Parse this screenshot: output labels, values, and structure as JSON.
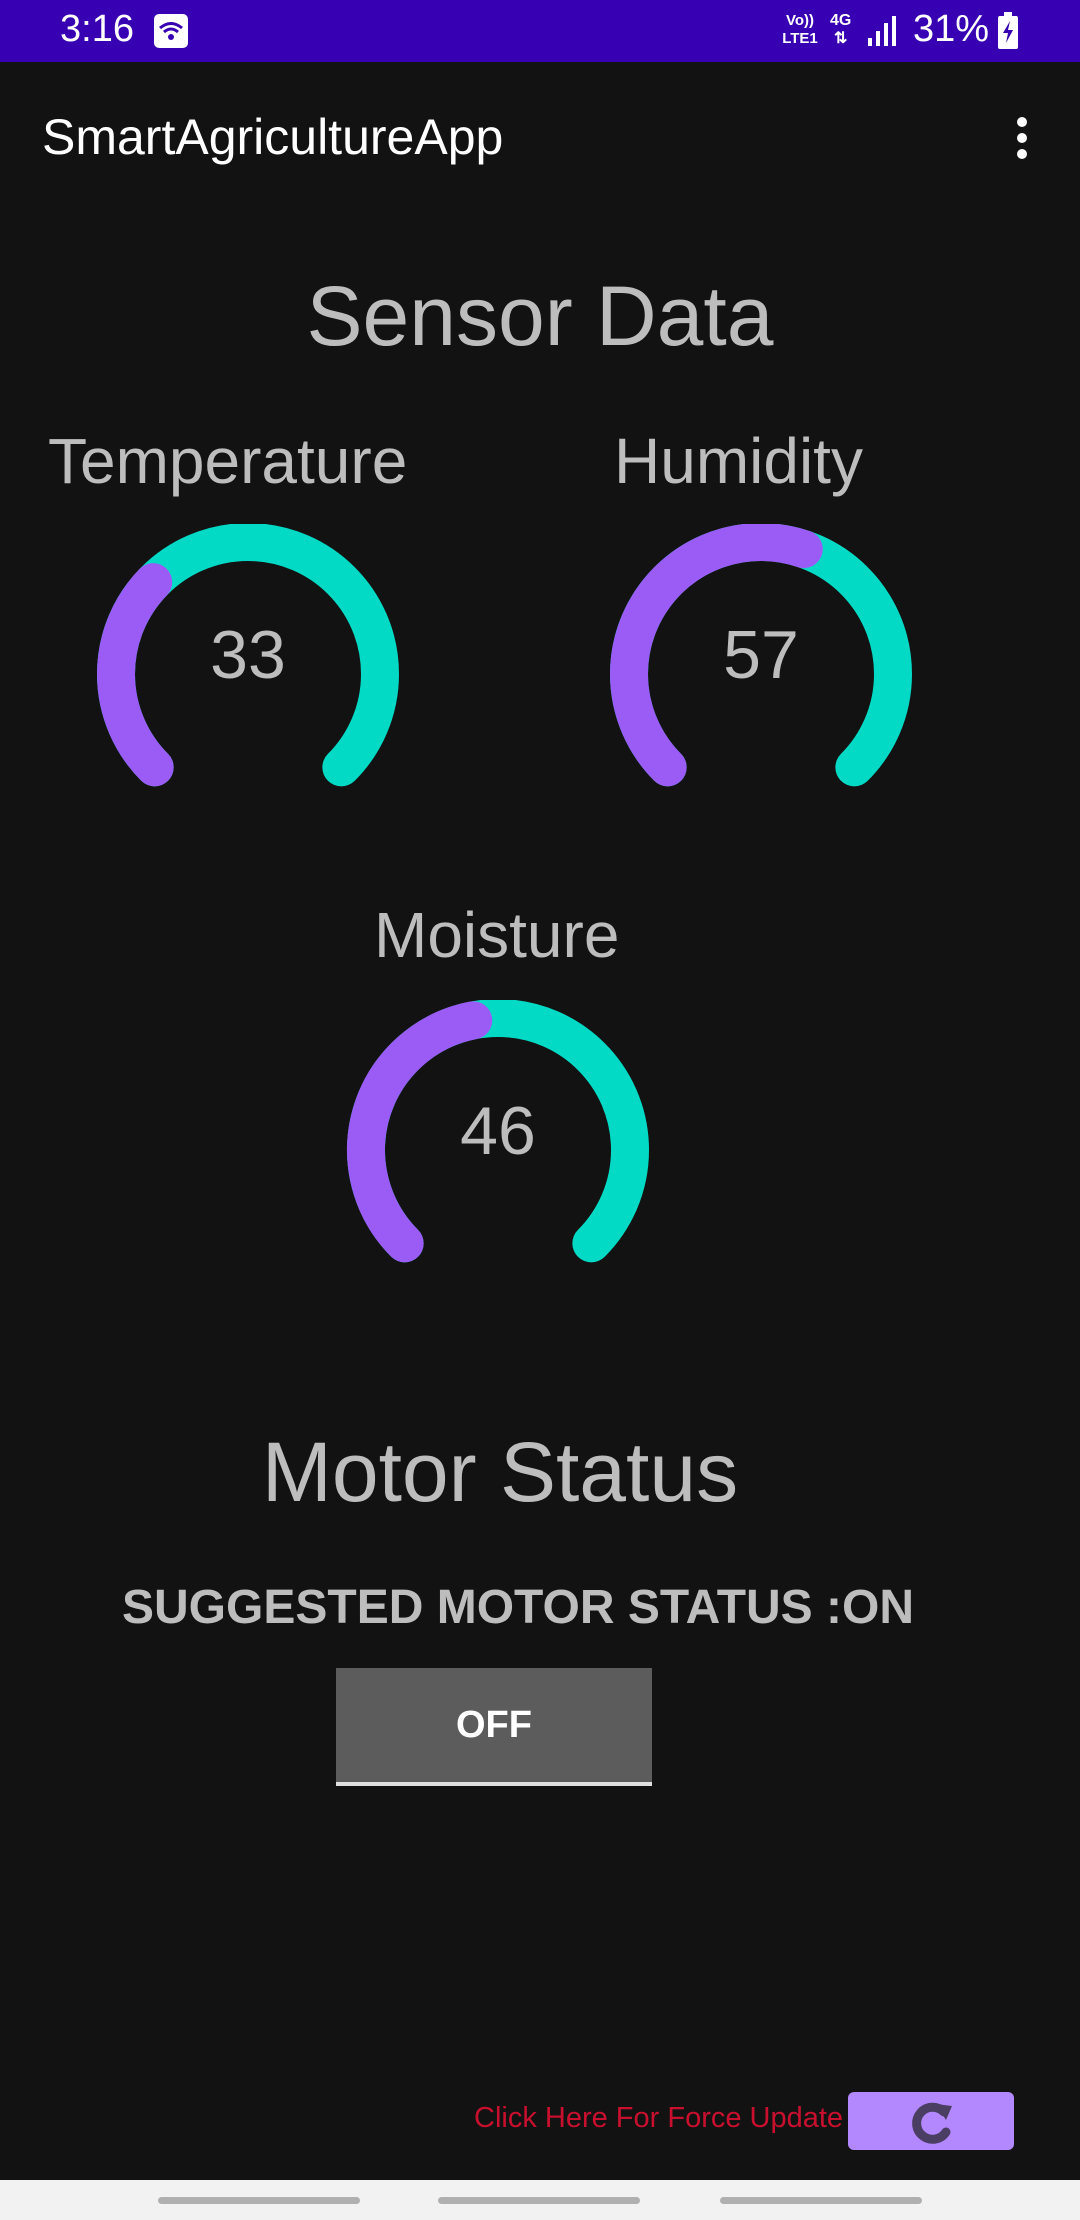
{
  "status_bar": {
    "time": "3:16",
    "volte_label": "Vo)) LTE1",
    "network_label": "4G",
    "battery_percent": "31%",
    "icons": [
      "wifi-icon",
      "volte-icon",
      "4g-icon",
      "signal-icon",
      "battery-charging-icon"
    ]
  },
  "app_bar": {
    "title": "SmartAgricultureApp",
    "menu_icon": "overflow-menu-icon"
  },
  "sensor": {
    "heading": "Sensor Data",
    "gauges": [
      {
        "label": "Temperature",
        "value": "33",
        "fraction": 0.33
      },
      {
        "label": "Humidity",
        "value": "57",
        "fraction": 0.57
      },
      {
        "label": "Moisture",
        "value": "46",
        "fraction": 0.46
      }
    ]
  },
  "motor": {
    "heading": "Motor Status",
    "suggested": "SUGGESTED MOTOR STATUS :ON",
    "toggle_label": "OFF"
  },
  "force_update": {
    "text": "Click Here For Force Update",
    "icon": "refresh-icon"
  },
  "colors": {
    "status_bar": "#3700b3",
    "background": "#121212",
    "gauge_fill": "#9b5cf6",
    "gauge_track": "#03dac5",
    "force_text": "#c8102e",
    "force_button": "#b388ff"
  }
}
